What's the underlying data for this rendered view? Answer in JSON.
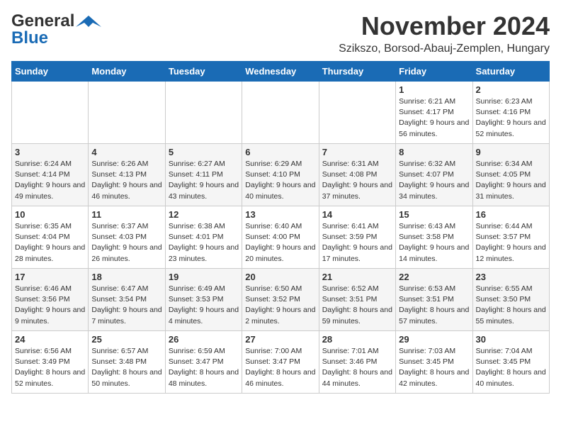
{
  "logo": {
    "general": "General",
    "blue": "Blue"
  },
  "title": "November 2024",
  "location": "Szikszo, Borsod-Abauj-Zemplen, Hungary",
  "days_of_week": [
    "Sunday",
    "Monday",
    "Tuesday",
    "Wednesday",
    "Thursday",
    "Friday",
    "Saturday"
  ],
  "weeks": [
    [
      {
        "day": "",
        "info": ""
      },
      {
        "day": "",
        "info": ""
      },
      {
        "day": "",
        "info": ""
      },
      {
        "day": "",
        "info": ""
      },
      {
        "day": "",
        "info": ""
      },
      {
        "day": "1",
        "info": "Sunrise: 6:21 AM\nSunset: 4:17 PM\nDaylight: 9 hours and 56 minutes."
      },
      {
        "day": "2",
        "info": "Sunrise: 6:23 AM\nSunset: 4:16 PM\nDaylight: 9 hours and 52 minutes."
      }
    ],
    [
      {
        "day": "3",
        "info": "Sunrise: 6:24 AM\nSunset: 4:14 PM\nDaylight: 9 hours and 49 minutes."
      },
      {
        "day": "4",
        "info": "Sunrise: 6:26 AM\nSunset: 4:13 PM\nDaylight: 9 hours and 46 minutes."
      },
      {
        "day": "5",
        "info": "Sunrise: 6:27 AM\nSunset: 4:11 PM\nDaylight: 9 hours and 43 minutes."
      },
      {
        "day": "6",
        "info": "Sunrise: 6:29 AM\nSunset: 4:10 PM\nDaylight: 9 hours and 40 minutes."
      },
      {
        "day": "7",
        "info": "Sunrise: 6:31 AM\nSunset: 4:08 PM\nDaylight: 9 hours and 37 minutes."
      },
      {
        "day": "8",
        "info": "Sunrise: 6:32 AM\nSunset: 4:07 PM\nDaylight: 9 hours and 34 minutes."
      },
      {
        "day": "9",
        "info": "Sunrise: 6:34 AM\nSunset: 4:05 PM\nDaylight: 9 hours and 31 minutes."
      }
    ],
    [
      {
        "day": "10",
        "info": "Sunrise: 6:35 AM\nSunset: 4:04 PM\nDaylight: 9 hours and 28 minutes."
      },
      {
        "day": "11",
        "info": "Sunrise: 6:37 AM\nSunset: 4:03 PM\nDaylight: 9 hours and 26 minutes."
      },
      {
        "day": "12",
        "info": "Sunrise: 6:38 AM\nSunset: 4:01 PM\nDaylight: 9 hours and 23 minutes."
      },
      {
        "day": "13",
        "info": "Sunrise: 6:40 AM\nSunset: 4:00 PM\nDaylight: 9 hours and 20 minutes."
      },
      {
        "day": "14",
        "info": "Sunrise: 6:41 AM\nSunset: 3:59 PM\nDaylight: 9 hours and 17 minutes."
      },
      {
        "day": "15",
        "info": "Sunrise: 6:43 AM\nSunset: 3:58 PM\nDaylight: 9 hours and 14 minutes."
      },
      {
        "day": "16",
        "info": "Sunrise: 6:44 AM\nSunset: 3:57 PM\nDaylight: 9 hours and 12 minutes."
      }
    ],
    [
      {
        "day": "17",
        "info": "Sunrise: 6:46 AM\nSunset: 3:56 PM\nDaylight: 9 hours and 9 minutes."
      },
      {
        "day": "18",
        "info": "Sunrise: 6:47 AM\nSunset: 3:54 PM\nDaylight: 9 hours and 7 minutes."
      },
      {
        "day": "19",
        "info": "Sunrise: 6:49 AM\nSunset: 3:53 PM\nDaylight: 9 hours and 4 minutes."
      },
      {
        "day": "20",
        "info": "Sunrise: 6:50 AM\nSunset: 3:52 PM\nDaylight: 9 hours and 2 minutes."
      },
      {
        "day": "21",
        "info": "Sunrise: 6:52 AM\nSunset: 3:51 PM\nDaylight: 8 hours and 59 minutes."
      },
      {
        "day": "22",
        "info": "Sunrise: 6:53 AM\nSunset: 3:51 PM\nDaylight: 8 hours and 57 minutes."
      },
      {
        "day": "23",
        "info": "Sunrise: 6:55 AM\nSunset: 3:50 PM\nDaylight: 8 hours and 55 minutes."
      }
    ],
    [
      {
        "day": "24",
        "info": "Sunrise: 6:56 AM\nSunset: 3:49 PM\nDaylight: 8 hours and 52 minutes."
      },
      {
        "day": "25",
        "info": "Sunrise: 6:57 AM\nSunset: 3:48 PM\nDaylight: 8 hours and 50 minutes."
      },
      {
        "day": "26",
        "info": "Sunrise: 6:59 AM\nSunset: 3:47 PM\nDaylight: 8 hours and 48 minutes."
      },
      {
        "day": "27",
        "info": "Sunrise: 7:00 AM\nSunset: 3:47 PM\nDaylight: 8 hours and 46 minutes."
      },
      {
        "day": "28",
        "info": "Sunrise: 7:01 AM\nSunset: 3:46 PM\nDaylight: 8 hours and 44 minutes."
      },
      {
        "day": "29",
        "info": "Sunrise: 7:03 AM\nSunset: 3:45 PM\nDaylight: 8 hours and 42 minutes."
      },
      {
        "day": "30",
        "info": "Sunrise: 7:04 AM\nSunset: 3:45 PM\nDaylight: 8 hours and 40 minutes."
      }
    ]
  ]
}
